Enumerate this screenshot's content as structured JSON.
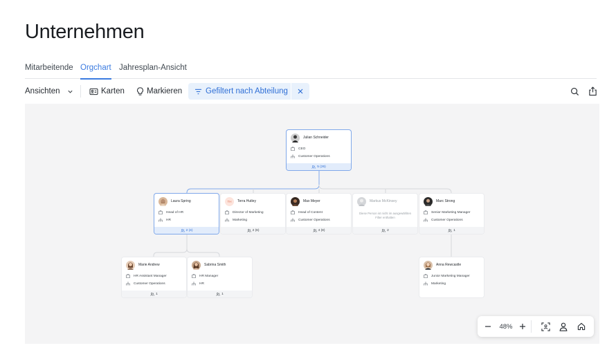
{
  "page": {
    "title": "Unternehmen"
  },
  "tabs": [
    {
      "label": "Mitarbeitende",
      "active": false
    },
    {
      "label": "Orgchart",
      "active": true
    },
    {
      "label": "Jahresplan-Ansicht",
      "active": false
    }
  ],
  "toolbar": {
    "views_label": "Ansichten",
    "cards_label": "Karten",
    "highlight_label": "Markieren",
    "filter_label": "Gefiltert nach Abteilung"
  },
  "colors": {
    "accent": "#3b7be0",
    "chip_bg": "#e8f1fc",
    "canvas_bg": "#f4f4f5"
  },
  "orgchart": {
    "ceo": {
      "name": "Julian Schneider",
      "title": "CEO",
      "department": "Customer Operations",
      "reports": "5 (26)"
    },
    "level1": [
      {
        "name": "Laura Spring",
        "title": "Head of HR",
        "department": "HR",
        "reports": "2 (4)"
      },
      {
        "name": "Terra Hutley",
        "initials": "TH",
        "title": "Director of Marketing",
        "department": "Marketing",
        "reports": "2 (6)"
      },
      {
        "name": "Max Meyer",
        "title": "Head of Content",
        "department": "Customer Operations",
        "reports": "4 (8)"
      },
      {
        "name": "Markus McKinsey",
        "hidden_note": "Diese Person ist nicht im ausgewählten Filter enthalten",
        "reports": "2"
      },
      {
        "name": "Marc Strong",
        "title": "Senior Marketing Manager",
        "department": "Customer Operations",
        "reports": "1"
      }
    ],
    "level2": [
      {
        "name": "Marie Andrew",
        "title": "HR Assistant Manager",
        "department": "Customer Operations",
        "reports": "1"
      },
      {
        "name": "Sabrina Smith",
        "title": "HR Manager",
        "department": "HR",
        "reports": "1"
      },
      {
        "name": "Anna Rewcastle",
        "title": "Junior Marketing Manager",
        "department": "Marketing"
      }
    ]
  },
  "zoom": {
    "level": "48%"
  }
}
